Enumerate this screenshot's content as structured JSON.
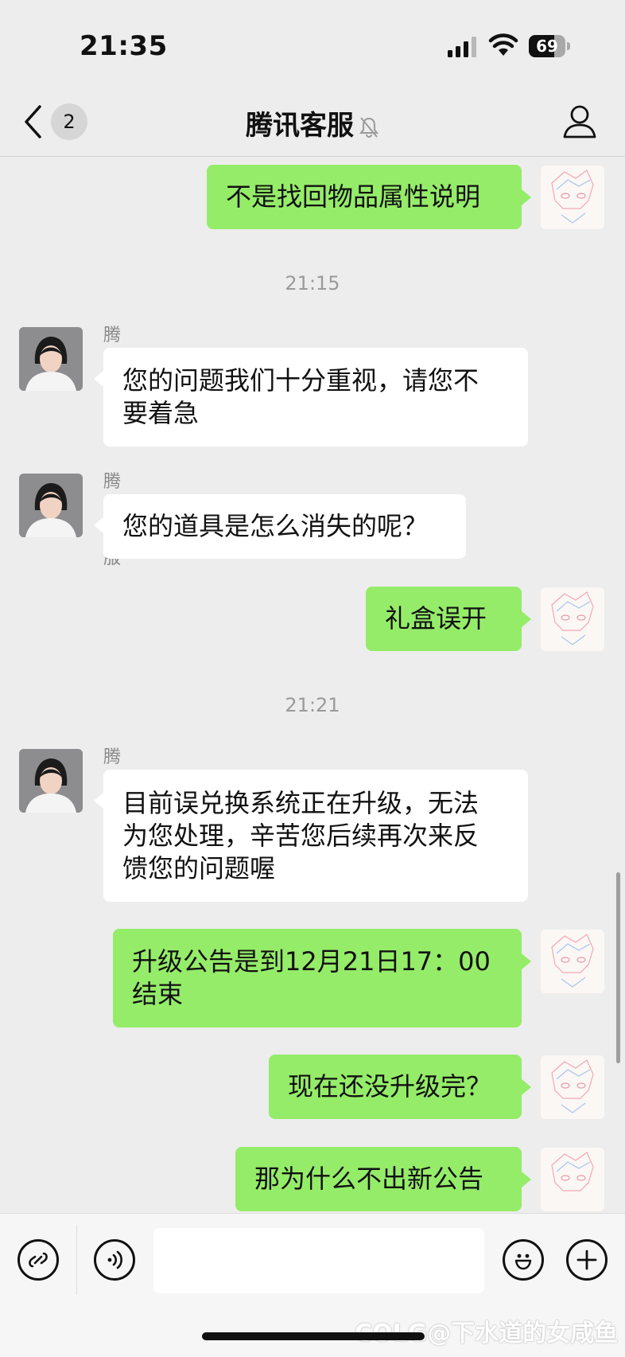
{
  "status_bar": {
    "time": "21:35",
    "battery": 69,
    "battery_label": "69"
  },
  "nav": {
    "back_badge": "2",
    "title": "腾讯客服"
  },
  "messages": [
    {
      "type": "outgoing",
      "text": "不是找回物品属性说明"
    },
    {
      "type": "timestamp",
      "text": "21:15"
    },
    {
      "type": "incoming",
      "sender": "腾讯客服",
      "lines": [
        "您的问题我们十分重视，请您不",
        "要着急"
      ]
    },
    {
      "type": "incoming",
      "sender": "腾讯客服",
      "lines": [
        "您的道具是怎么消失的呢？"
      ]
    },
    {
      "type": "outgoing",
      "text": "礼盒误开"
    },
    {
      "type": "timestamp",
      "text": "21:21"
    },
    {
      "type": "incoming",
      "sender": "腾讯客服",
      "lines": [
        "目前误兑换系统正在升级，无法",
        "为您处理，辛苦您后续再次来反",
        "馈您的问题喔"
      ]
    },
    {
      "type": "outgoing",
      "lines": [
        "升级公告是到12月21日17：00",
        "结束"
      ]
    },
    {
      "type": "outgoing",
      "text": "现在还没升级完？"
    },
    {
      "type": "outgoing",
      "text": "那为什么不出新公告"
    }
  ],
  "input": {
    "value": "",
    "placeholder": ""
  },
  "icons": {
    "signal": "signal-icon",
    "wifi": "wifi-icon",
    "back": "chevron-left-icon",
    "mute": "bell-slash-icon",
    "profile": "person-icon",
    "mini_program": "link-icon",
    "voice": "voice-icon",
    "emoji": "smiley-icon",
    "add": "plus-icon"
  },
  "colors": {
    "outgoing_bubble": "#95ec69",
    "incoming_bubble": "#ffffff",
    "background": "#ededed"
  },
  "watermark": "COLG@下水道的女咸鱼"
}
